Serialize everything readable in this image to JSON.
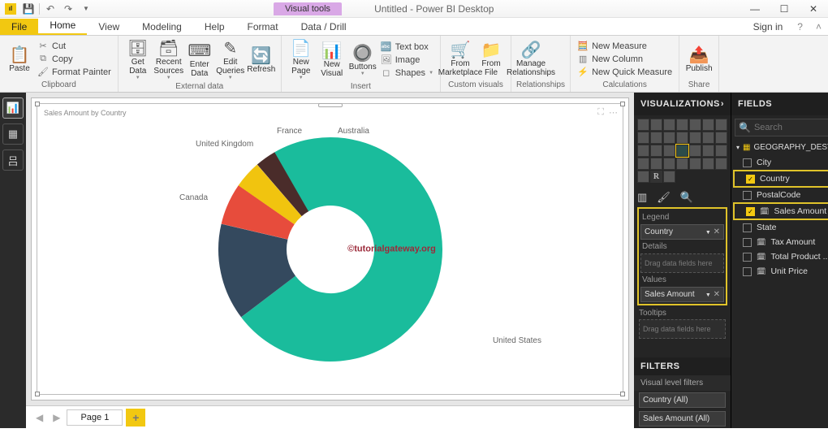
{
  "window": {
    "title": "Untitled - Power BI Desktop",
    "context_tab": "Visual tools",
    "signin": "Sign in"
  },
  "tabs": {
    "file": "File",
    "home": "Home",
    "view": "View",
    "modeling": "Modeling",
    "help": "Help",
    "format": "Format",
    "datadrill": "Data / Drill"
  },
  "ribbon": {
    "clipboard": {
      "label": "Clipboard",
      "paste": "Paste",
      "cut": "Cut",
      "copy": "Copy",
      "painter": "Format Painter"
    },
    "external": {
      "label": "External data",
      "get": "Get\nData",
      "recent": "Recent\nSources",
      "enter": "Enter\nData",
      "edit": "Edit\nQueries",
      "refresh": "Refresh"
    },
    "insert": {
      "label": "Insert",
      "page": "New\nPage",
      "visual": "New\nVisual",
      "buttons": "Buttons",
      "textbox": "Text box",
      "image": "Image",
      "shapes": "Shapes"
    },
    "custom": {
      "label": "Custom visuals",
      "market": "From\nMarketplace",
      "file": "From\nFile"
    },
    "rel": {
      "label": "Relationships",
      "manage": "Manage\nRelationships"
    },
    "calc": {
      "label": "Calculations",
      "measure": "New Measure",
      "column": "New Column",
      "quick": "New Quick Measure"
    },
    "share": {
      "label": "Share",
      "publish": "Publish"
    }
  },
  "chart": {
    "title": "Sales Amount by Country",
    "watermark": "©tutorialgateway.org",
    "labels": {
      "us": "United States",
      "uk": "United Kingdom",
      "ca": "Canada",
      "fr": "France",
      "au": "Australia"
    }
  },
  "chart_data": {
    "type": "pie",
    "title": "Sales Amount by Country",
    "series": [
      {
        "name": "Sales Amount",
        "values": [
          73,
          14,
          6,
          4,
          3
        ]
      }
    ],
    "categories": [
      "United States",
      "Canada",
      "United Kingdom",
      "France",
      "Australia"
    ],
    "colors": [
      "#1abc9c",
      "#34495e",
      "#e74c3c",
      "#f1c40f",
      "#4a2c2a"
    ],
    "donut_inner_radius_pct": 55
  },
  "pagetabs": {
    "page1": "Page 1"
  },
  "viz": {
    "header": "VISUALIZATIONS",
    "wells": {
      "legend": "Legend",
      "legend_val": "Country",
      "details": "Details",
      "details_ph": "Drag data fields here",
      "values": "Values",
      "values_val": "Sales Amount",
      "tooltips": "Tooltips",
      "tooltips_ph": "Drag data fields here"
    },
    "filters_header": "FILTERS",
    "filters_sub": "Visual level filters",
    "filter1": "Country  (All)",
    "filter2": "Sales Amount (All)"
  },
  "fields": {
    "header": "FIELDS",
    "search_ph": "Search",
    "table": "GEOGRAPHY_DESTI...",
    "items": {
      "city": "City",
      "country": "Country",
      "postal": "PostalCode",
      "sales": "Sales Amount",
      "state": "State",
      "tax": "Tax Amount",
      "totalprod": "Total Product ...",
      "unit": "Unit Price"
    }
  }
}
